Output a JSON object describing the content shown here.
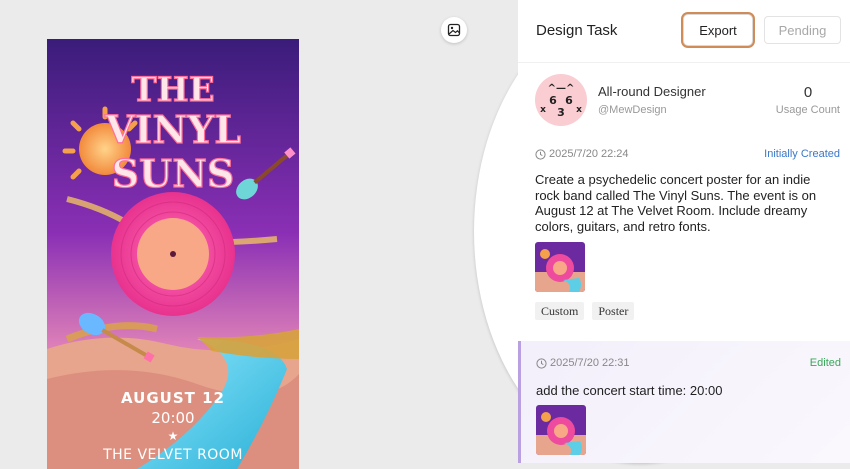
{
  "canvas": {
    "tools": [
      {
        "name": "image-icon"
      },
      {
        "name": "panel-toggle-icon"
      }
    ],
    "poster": {
      "title_lines": [
        "THE",
        "VINYL",
        "SUNS"
      ],
      "date": "AUGUST 12",
      "time": "20:00",
      "separator": "★",
      "venue": "THE VELVET ROOM"
    }
  },
  "panel": {
    "title": "Design Task",
    "export_label": "Export",
    "pending_label": "Pending",
    "designer": {
      "name": "All-round Designer",
      "handle": "@MewDesign",
      "usage_count": "0",
      "usage_label": "Usage Count"
    },
    "entries": [
      {
        "timestamp": "2025/7/20 22:24",
        "status": "Initially Created",
        "prompt": "Create a psychedelic concert poster for an indie rock band called The Vinyl Suns. The event is on August 12 at The Velvet Room. Include dreamy colors, guitars, and retro fonts.",
        "tags": [
          "Custom",
          "Poster"
        ]
      },
      {
        "timestamp": "2025/7/20 22:31",
        "status": "Edited",
        "prompt": "add the concert start time: 20:00"
      }
    ]
  },
  "colors": {
    "accent_export": "#cf8b58",
    "status_created": "#3a78c9",
    "status_edited": "#3aa65a",
    "avatar_bg": "#f9cdd1"
  }
}
